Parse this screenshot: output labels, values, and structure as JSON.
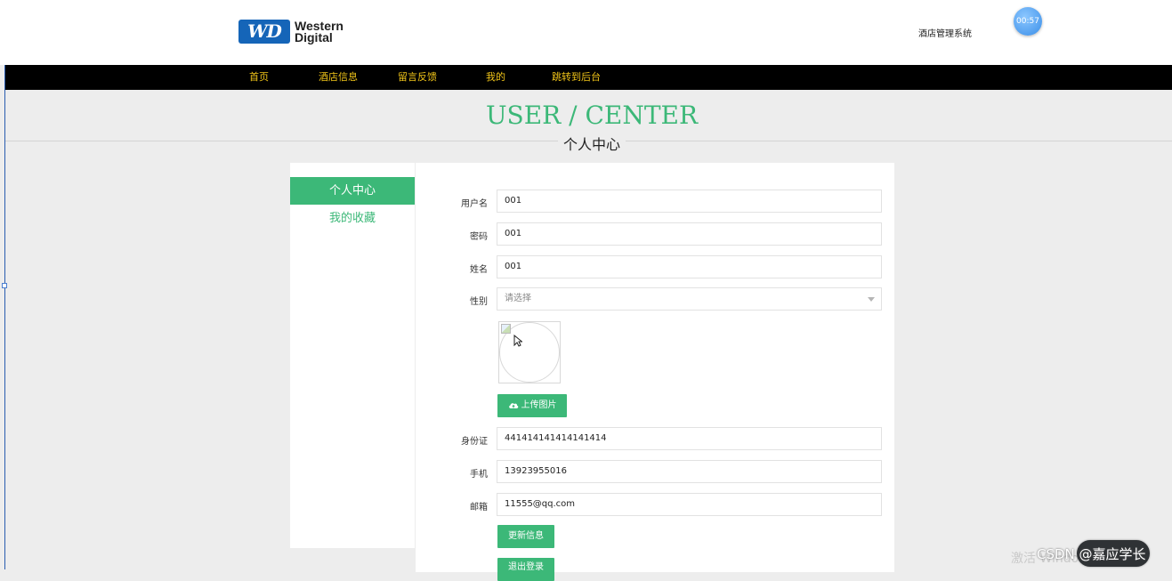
{
  "header": {
    "logo_badge": "WD",
    "logo_line1": "Western",
    "logo_line2": "Digital",
    "site_title": "酒店管理系统",
    "clock_time": "00:57"
  },
  "nav": {
    "items": [
      "首页",
      "酒店信息",
      "留言反馈",
      "我的",
      "跳转到后台"
    ],
    "color": "#f0c419",
    "background": "#000000"
  },
  "section": {
    "title_en": "USER / CENTER",
    "title_cn": "个人中心",
    "accent_color": "#3cb878"
  },
  "sidebar": {
    "items": [
      {
        "label": "个人中心",
        "active": true
      },
      {
        "label": "我的收藏",
        "active": false
      }
    ]
  },
  "form": {
    "username": {
      "label": "用户名",
      "value": "001"
    },
    "password": {
      "label": "密码",
      "value": "001"
    },
    "name": {
      "label": "姓名",
      "value": "001"
    },
    "gender": {
      "label": "性别",
      "placeholder": "请选择"
    },
    "upload_button": "上传图片",
    "id_card": {
      "label": "身份证",
      "value": "441414141414141414"
    },
    "phone": {
      "label": "手机",
      "value": "13923955016"
    },
    "email": {
      "label": "邮箱",
      "value": "11555@qq.com"
    },
    "update_button": "更新信息",
    "logout_button": "退出登录"
  },
  "overlay": {
    "windows_activate": "激活 Windows",
    "csdn_watermark": "CSDN @嘉应学长"
  }
}
